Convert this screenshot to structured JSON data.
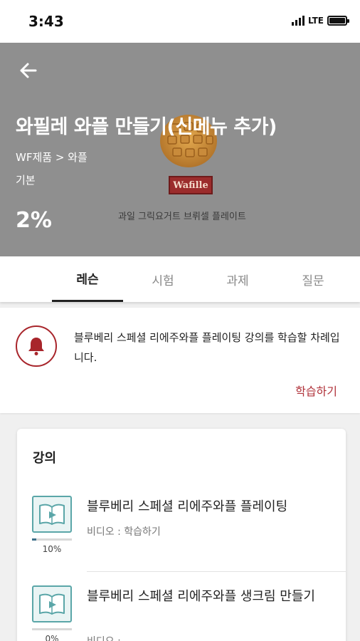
{
  "status_bar": {
    "time": "3:43",
    "network": "LTE"
  },
  "hero": {
    "title": "와필레 와플 만들기(신메뉴 추가)",
    "breadcrumb": "WF제품 > 와플",
    "level": "기본",
    "progress": "2%",
    "brand": "Wafille",
    "caption": "과일 그릭요거트 브뤼셀 플레이트"
  },
  "tabs": [
    {
      "label": "레슨",
      "active": true
    },
    {
      "label": "시험",
      "active": false
    },
    {
      "label": "과제",
      "active": false
    },
    {
      "label": "질문",
      "active": false
    }
  ],
  "notice": {
    "text": "블루베리 스페셜 리에주와플 플레이팅 강의를 학습할 차례입니다.",
    "action": "학습하기",
    "accent_color": "#a8252b"
  },
  "lectures": {
    "title": "강의",
    "items": [
      {
        "title": "블루베리 스페셜 리에주와플 플레이팅",
        "meta": "비디오 : 학습하기",
        "progress": "10%",
        "progress_value": 0.1
      },
      {
        "title": "블루베리 스페셜 리에주와플 생크림 만들기",
        "meta": "비디오 :",
        "progress": "0%",
        "progress_value": 0
      }
    ]
  }
}
